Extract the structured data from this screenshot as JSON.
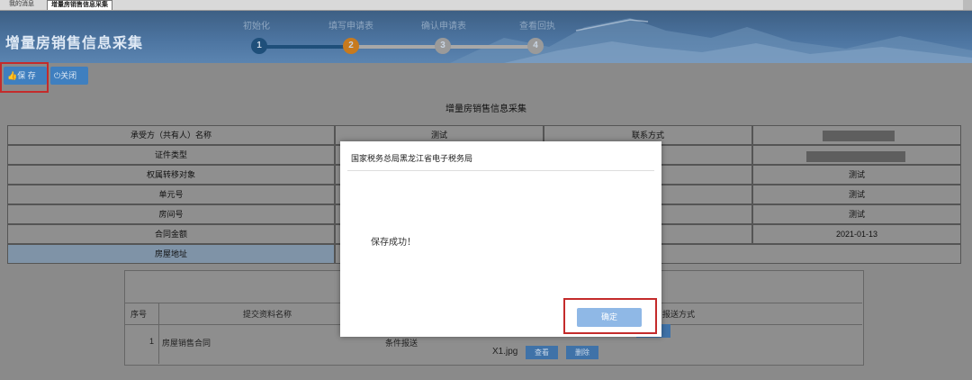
{
  "tabs": [
    {
      "label": "我的消息"
    },
    {
      "label": "增量房销售信息采集"
    }
  ],
  "banner": {
    "title": "增量房销售信息采集",
    "steps": [
      {
        "label": "初始化",
        "number": "1",
        "state": "done"
      },
      {
        "label": "填写申请表",
        "number": "2",
        "state": "current"
      },
      {
        "label": "确认申请表",
        "number": "3",
        "state": "todo"
      },
      {
        "label": "查看回执",
        "number": "4",
        "state": "todo"
      }
    ]
  },
  "toolbar": {
    "save_label": "保 存",
    "close_label": "关闭"
  },
  "form": {
    "title": "增量房销售信息采集",
    "rows": [
      {
        "label": "承受方（共有人）名称",
        "value": "测试",
        "label2": "联系方式",
        "value2": ""
      },
      {
        "label": "证件类型",
        "value": "",
        "label2": "",
        "value2": ""
      },
      {
        "label": "权属转移对象",
        "value": "",
        "label2": "",
        "value2": "测试"
      },
      {
        "label": "单元号",
        "value": "",
        "label2": "",
        "value2": "测试"
      },
      {
        "label": "房间号",
        "value": "",
        "label2": "",
        "value2": "测试"
      },
      {
        "label": "合同金额",
        "value": "",
        "label2": "间",
        "value2": "2021-01-13"
      },
      {
        "label": "房屋地址",
        "value": "",
        "label2": "",
        "value2": ""
      }
    ]
  },
  "materials": {
    "headers": {
      "seq": "序号",
      "name": "提交资料名称",
      "method": "报送方式"
    },
    "rows": [
      {
        "seq": "1",
        "name": "房屋销售合同",
        "type": "条件报送",
        "file": "X1.jpg",
        "view_label": "查看",
        "delete_label": "删除"
      }
    ]
  },
  "dialog": {
    "title": "国家税务总局黑龙江省电子税务局",
    "message": "保存成功！",
    "ok_label": "确定"
  }
}
